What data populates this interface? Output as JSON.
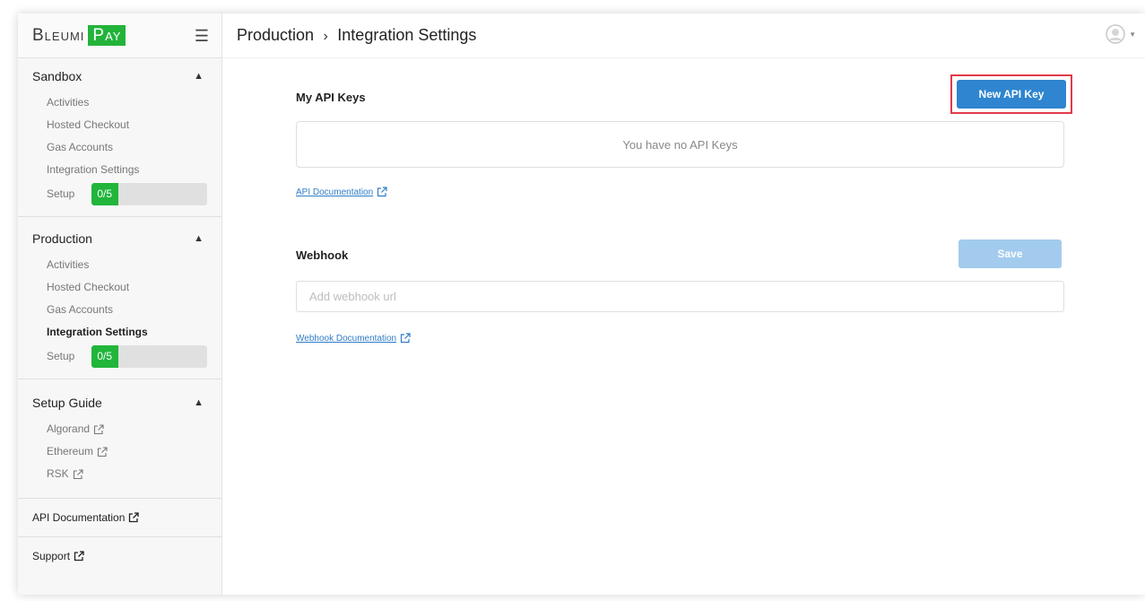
{
  "brand": {
    "word": "Bleumi",
    "pay": "Pay"
  },
  "header": {
    "crumb_parent": "Production",
    "crumb_sep": "›",
    "crumb_current": "Integration Settings"
  },
  "sidebar": {
    "sandbox": {
      "title": "Sandbox",
      "items": [
        "Activities",
        "Hosted Checkout",
        "Gas Accounts",
        "Integration Settings"
      ],
      "setup_label": "Setup",
      "setup_progress": "0/5"
    },
    "production": {
      "title": "Production",
      "items": [
        "Activities",
        "Hosted Checkout",
        "Gas Accounts",
        "Integration Settings"
      ],
      "active_index": 3,
      "setup_label": "Setup",
      "setup_progress": "0/5"
    },
    "setup_guide": {
      "title": "Setup Guide",
      "items": [
        "Algorand",
        "Ethereum",
        "RSK"
      ]
    },
    "api_documentation": "API Documentation",
    "support": "Support"
  },
  "api_keys": {
    "title": "My API Keys",
    "new_button": "New API Key",
    "empty_message": "You have no API Keys",
    "doc_link": "API Documentation"
  },
  "webhook": {
    "title": "Webhook",
    "save_button": "Save",
    "placeholder": "Add webhook url",
    "value": "",
    "doc_link": "Webhook Documentation"
  },
  "colors": {
    "brand_green": "#23b33a",
    "primary_blue": "#2f85cf",
    "disabled_blue": "#a3cbed",
    "highlight_red": "#e03a4a",
    "link_blue": "#2f7dc6"
  },
  "icons": {
    "external": "external-link-icon",
    "menu": "hamburger-icon",
    "collapse": "chevron-up-icon",
    "user": "user-avatar-icon"
  }
}
